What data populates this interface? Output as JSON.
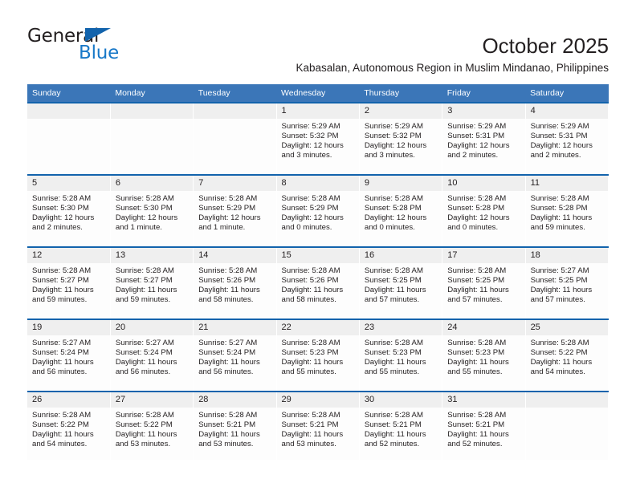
{
  "brand": {
    "name_top": "General",
    "name_bottom": "Blue",
    "triangle_icon": "triangle-icon",
    "accent_color": "#1263ac",
    "blue_text_color": "#1878c8"
  },
  "header": {
    "title": "October 2025",
    "subtitle": "Kabasalan, Autonomous Region in Muslim Mindanao, Philippines"
  },
  "calendar": {
    "header_bg": "#3b76b8",
    "row_border_color": "#1263ac",
    "daynum_bg": "#efefef",
    "weekdays": [
      "Sunday",
      "Monday",
      "Tuesday",
      "Wednesday",
      "Thursday",
      "Friday",
      "Saturday"
    ],
    "labels": {
      "sunrise": "Sunrise:",
      "sunset": "Sunset:",
      "daylight": "Daylight:"
    },
    "weeks": [
      [
        {
          "day": "",
          "sunrise": "",
          "sunset": "",
          "daylight": "",
          "empty": true
        },
        {
          "day": "",
          "sunrise": "",
          "sunset": "",
          "daylight": "",
          "empty": true
        },
        {
          "day": "",
          "sunrise": "",
          "sunset": "",
          "daylight": "",
          "empty": true
        },
        {
          "day": "1",
          "sunrise": "Sunrise: 5:29 AM",
          "sunset": "Sunset: 5:32 PM",
          "daylight": "Daylight: 12 hours and 3 minutes."
        },
        {
          "day": "2",
          "sunrise": "Sunrise: 5:29 AM",
          "sunset": "Sunset: 5:32 PM",
          "daylight": "Daylight: 12 hours and 3 minutes."
        },
        {
          "day": "3",
          "sunrise": "Sunrise: 5:29 AM",
          "sunset": "Sunset: 5:31 PM",
          "daylight": "Daylight: 12 hours and 2 minutes."
        },
        {
          "day": "4",
          "sunrise": "Sunrise: 5:29 AM",
          "sunset": "Sunset: 5:31 PM",
          "daylight": "Daylight: 12 hours and 2 minutes."
        }
      ],
      [
        {
          "day": "5",
          "sunrise": "Sunrise: 5:28 AM",
          "sunset": "Sunset: 5:30 PM",
          "daylight": "Daylight: 12 hours and 2 minutes."
        },
        {
          "day": "6",
          "sunrise": "Sunrise: 5:28 AM",
          "sunset": "Sunset: 5:30 PM",
          "daylight": "Daylight: 12 hours and 1 minute."
        },
        {
          "day": "7",
          "sunrise": "Sunrise: 5:28 AM",
          "sunset": "Sunset: 5:29 PM",
          "daylight": "Daylight: 12 hours and 1 minute."
        },
        {
          "day": "8",
          "sunrise": "Sunrise: 5:28 AM",
          "sunset": "Sunset: 5:29 PM",
          "daylight": "Daylight: 12 hours and 0 minutes."
        },
        {
          "day": "9",
          "sunrise": "Sunrise: 5:28 AM",
          "sunset": "Sunset: 5:28 PM",
          "daylight": "Daylight: 12 hours and 0 minutes."
        },
        {
          "day": "10",
          "sunrise": "Sunrise: 5:28 AM",
          "sunset": "Sunset: 5:28 PM",
          "daylight": "Daylight: 12 hours and 0 minutes."
        },
        {
          "day": "11",
          "sunrise": "Sunrise: 5:28 AM",
          "sunset": "Sunset: 5:28 PM",
          "daylight": "Daylight: 11 hours and 59 minutes."
        }
      ],
      [
        {
          "day": "12",
          "sunrise": "Sunrise: 5:28 AM",
          "sunset": "Sunset: 5:27 PM",
          "daylight": "Daylight: 11 hours and 59 minutes."
        },
        {
          "day": "13",
          "sunrise": "Sunrise: 5:28 AM",
          "sunset": "Sunset: 5:27 PM",
          "daylight": "Daylight: 11 hours and 59 minutes."
        },
        {
          "day": "14",
          "sunrise": "Sunrise: 5:28 AM",
          "sunset": "Sunset: 5:26 PM",
          "daylight": "Daylight: 11 hours and 58 minutes."
        },
        {
          "day": "15",
          "sunrise": "Sunrise: 5:28 AM",
          "sunset": "Sunset: 5:26 PM",
          "daylight": "Daylight: 11 hours and 58 minutes."
        },
        {
          "day": "16",
          "sunrise": "Sunrise: 5:28 AM",
          "sunset": "Sunset: 5:25 PM",
          "daylight": "Daylight: 11 hours and 57 minutes."
        },
        {
          "day": "17",
          "sunrise": "Sunrise: 5:28 AM",
          "sunset": "Sunset: 5:25 PM",
          "daylight": "Daylight: 11 hours and 57 minutes."
        },
        {
          "day": "18",
          "sunrise": "Sunrise: 5:27 AM",
          "sunset": "Sunset: 5:25 PM",
          "daylight": "Daylight: 11 hours and 57 minutes."
        }
      ],
      [
        {
          "day": "19",
          "sunrise": "Sunrise: 5:27 AM",
          "sunset": "Sunset: 5:24 PM",
          "daylight": "Daylight: 11 hours and 56 minutes."
        },
        {
          "day": "20",
          "sunrise": "Sunrise: 5:27 AM",
          "sunset": "Sunset: 5:24 PM",
          "daylight": "Daylight: 11 hours and 56 minutes."
        },
        {
          "day": "21",
          "sunrise": "Sunrise: 5:27 AM",
          "sunset": "Sunset: 5:24 PM",
          "daylight": "Daylight: 11 hours and 56 minutes."
        },
        {
          "day": "22",
          "sunrise": "Sunrise: 5:28 AM",
          "sunset": "Sunset: 5:23 PM",
          "daylight": "Daylight: 11 hours and 55 minutes."
        },
        {
          "day": "23",
          "sunrise": "Sunrise: 5:28 AM",
          "sunset": "Sunset: 5:23 PM",
          "daylight": "Daylight: 11 hours and 55 minutes."
        },
        {
          "day": "24",
          "sunrise": "Sunrise: 5:28 AM",
          "sunset": "Sunset: 5:23 PM",
          "daylight": "Daylight: 11 hours and 55 minutes."
        },
        {
          "day": "25",
          "sunrise": "Sunrise: 5:28 AM",
          "sunset": "Sunset: 5:22 PM",
          "daylight": "Daylight: 11 hours and 54 minutes."
        }
      ],
      [
        {
          "day": "26",
          "sunrise": "Sunrise: 5:28 AM",
          "sunset": "Sunset: 5:22 PM",
          "daylight": "Daylight: 11 hours and 54 minutes."
        },
        {
          "day": "27",
          "sunrise": "Sunrise: 5:28 AM",
          "sunset": "Sunset: 5:22 PM",
          "daylight": "Daylight: 11 hours and 53 minutes."
        },
        {
          "day": "28",
          "sunrise": "Sunrise: 5:28 AM",
          "sunset": "Sunset: 5:21 PM",
          "daylight": "Daylight: 11 hours and 53 minutes."
        },
        {
          "day": "29",
          "sunrise": "Sunrise: 5:28 AM",
          "sunset": "Sunset: 5:21 PM",
          "daylight": "Daylight: 11 hours and 53 minutes."
        },
        {
          "day": "30",
          "sunrise": "Sunrise: 5:28 AM",
          "sunset": "Sunset: 5:21 PM",
          "daylight": "Daylight: 11 hours and 52 minutes."
        },
        {
          "day": "31",
          "sunrise": "Sunrise: 5:28 AM",
          "sunset": "Sunset: 5:21 PM",
          "daylight": "Daylight: 11 hours and 52 minutes."
        },
        {
          "day": "",
          "sunrise": "",
          "sunset": "",
          "daylight": "",
          "empty": true
        }
      ]
    ]
  }
}
